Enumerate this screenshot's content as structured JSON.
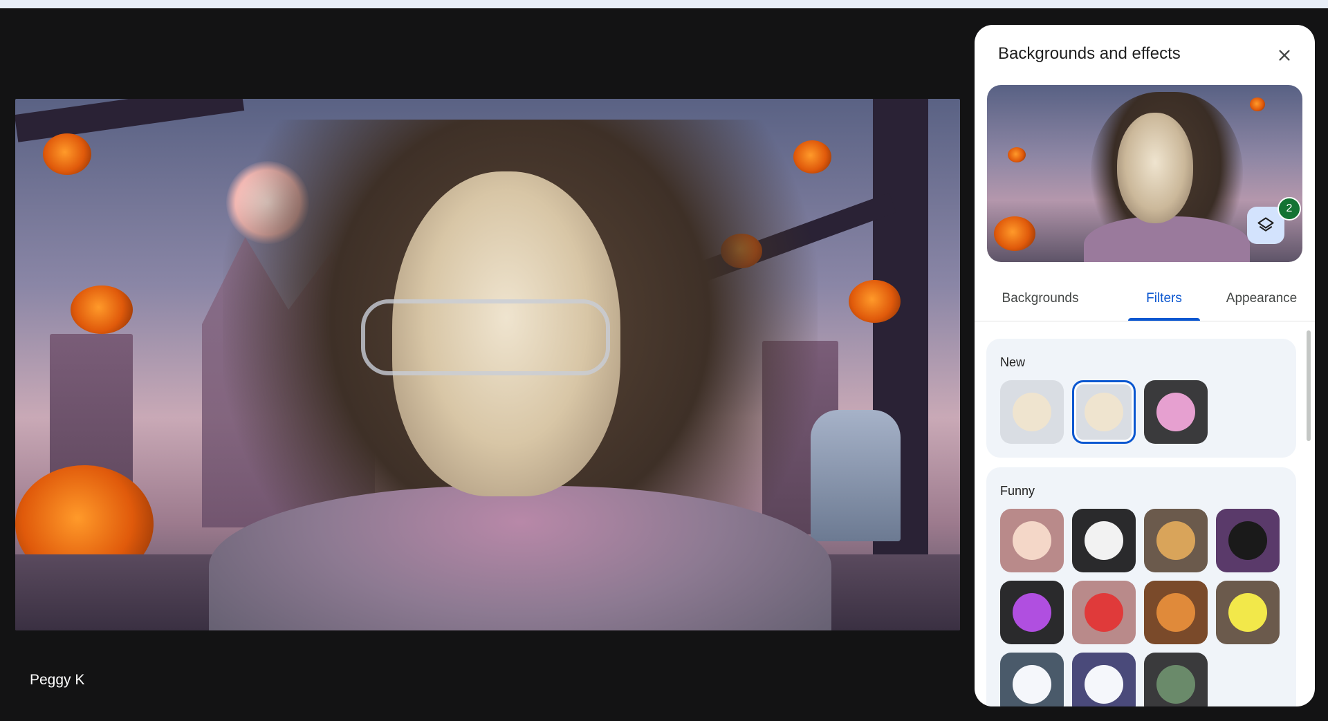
{
  "participant": {
    "name": "Peggy K"
  },
  "panel": {
    "title": "Backgrounds and effects",
    "close_icon": "close-icon",
    "preview": {
      "layers_icon": "layers-icon",
      "applied_count": "2"
    },
    "tabs": [
      {
        "label": "Backgrounds",
        "active": false
      },
      {
        "label": "Filters",
        "active": true
      },
      {
        "label": "Appearance",
        "active": false
      }
    ],
    "sections": [
      {
        "title": "New",
        "filters": [
          {
            "name": "zombie-face-filter",
            "bg": "#d9dde3",
            "selected": false
          },
          {
            "name": "mummy-face-filter",
            "bg": "#d9dde3",
            "selected": true
          },
          {
            "name": "party-hat-filter",
            "bg": "#3a3a3c",
            "selected": false
          }
        ]
      },
      {
        "title": "Funny",
        "filters": [
          {
            "name": "cake-filter",
            "bg": "#b98a8a",
            "selected": false
          },
          {
            "name": "fried-egg-filter",
            "bg": "#2a2a2c",
            "selected": false
          },
          {
            "name": "flying-cat-filter",
            "bg": "#6b5a4c",
            "selected": false
          },
          {
            "name": "black-cat-filter",
            "bg": "#5a3a6a",
            "selected": false
          },
          {
            "name": "octopus-filter",
            "bg": "#2a2a2c",
            "selected": false
          },
          {
            "name": "strawberry-filter",
            "bg": "#b98a8a",
            "selected": false
          },
          {
            "name": "orange-cat-filter",
            "bg": "#7a4a2a",
            "selected": false
          },
          {
            "name": "lightbulb-filter",
            "bg": "#6b5a4c",
            "selected": false
          },
          {
            "name": "bunny-filter",
            "bg": "#4a5a6a",
            "selected": false
          },
          {
            "name": "panda-filter",
            "bg": "#4a4a7a",
            "selected": false
          },
          {
            "name": "alien-filter",
            "bg": "#3a3a3c",
            "selected": false
          }
        ]
      }
    ]
  },
  "colors": {
    "accent": "#0b57d0",
    "badge": "#137333",
    "page_bg": "#131314"
  }
}
